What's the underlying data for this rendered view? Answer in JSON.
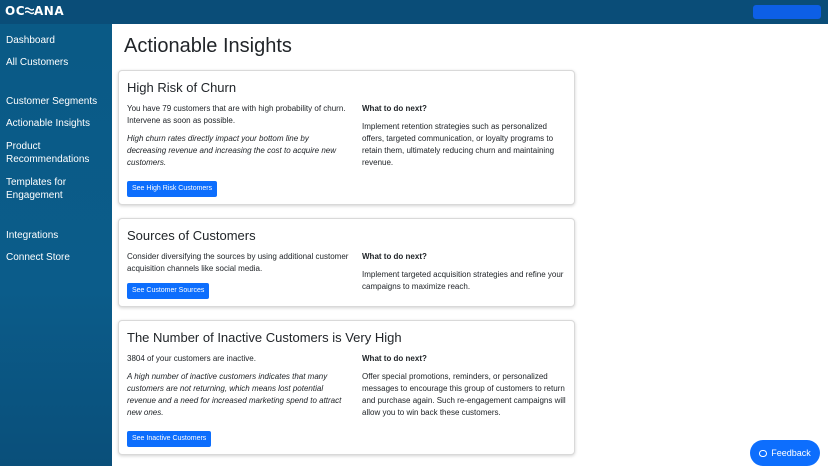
{
  "brand": {
    "logo_text_a": "OC",
    "logo_text_b": "ANA"
  },
  "sidebar": {
    "items": [
      {
        "label": "Dashboard"
      },
      {
        "label": "All Customers"
      },
      {
        "label": "Customer Segments"
      },
      {
        "label": "Actionable Insights"
      },
      {
        "label": "Product Recommendations"
      },
      {
        "label": "Templates for Engagement"
      },
      {
        "label": "Integrations"
      },
      {
        "label": "Connect Store"
      }
    ]
  },
  "main": {
    "title": "Actionable Insights",
    "next_heading": "What to do next?",
    "cards": [
      {
        "title": "High Risk of Churn",
        "text": "You have 79 customers that are with high probability of churn. Intervene as soon as possible.",
        "italic": "High churn rates directly impact your bottom line by decreasing revenue and increasing the cost to acquire new customers.",
        "button": "See High Risk Customers",
        "next": "Implement retention strategies such as personalized offers, targeted communication, or loyalty programs to retain them, ultimately reducing churn and maintaining revenue."
      },
      {
        "title": "Sources of Customers",
        "text": "Consider diversifying the sources by using additional customer acquisition channels like social media.",
        "button": "See Customer Sources",
        "next": "Implement targeted acquisition strategies and refine your campaigns to maximize reach."
      },
      {
        "title": "The Number of Inactive Customers is Very High",
        "text": "3804 of your customers are inactive.",
        "italic": "A high number of inactive customers indicates that many customers are not returning, which means lost potential revenue and a need for increased marketing spend to attract new ones.",
        "button": "See Inactive Customers",
        "next": "Offer special promotions, reminders, or personalized messages to encourage this group of customers to return and purchase again. Such re-engagement campaigns will allow you to win back these customers."
      }
    ]
  },
  "feedback": {
    "label": "Feedback",
    "icon": "chat-bubble-icon"
  },
  "colors": {
    "topbar": "#0a4d78",
    "sidebar": "#0b5c8a",
    "primary": "#0d6efd"
  }
}
